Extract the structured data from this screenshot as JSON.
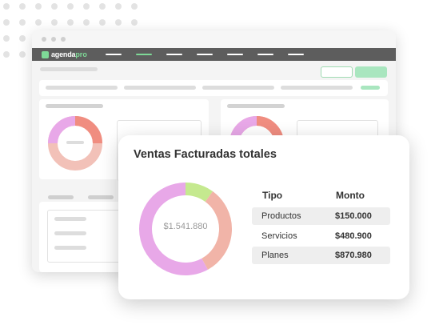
{
  "background": {
    "dot_color": "#e3e3e3"
  },
  "browser": {
    "brand": {
      "name_white": "agenda",
      "name_green": "pro",
      "accent": "#7ed997"
    },
    "navbar_color": "#5d5d5d"
  },
  "sales_card": {
    "title": "Ventas Facturadas totales",
    "total_label": "$1.541.880",
    "table": {
      "headers": {
        "tipo": "Tipo",
        "monto": "Monto"
      },
      "rows": [
        {
          "tipo": "Productos",
          "monto": "$150.000"
        },
        {
          "tipo": "Servicios",
          "monto": "$480.900"
        },
        {
          "tipo": "Planes",
          "monto": "$870.980"
        }
      ]
    }
  },
  "chart_data": {
    "type": "pie",
    "title": "Ventas Facturadas totales",
    "center_label": "$1.541.880",
    "categories": [
      "Productos",
      "Servicios",
      "Planes"
    ],
    "values": [
      150000,
      480900,
      870980
    ],
    "colors": [
      "#c5e98f",
      "#f1b4a8",
      "#e8a8e8"
    ]
  }
}
